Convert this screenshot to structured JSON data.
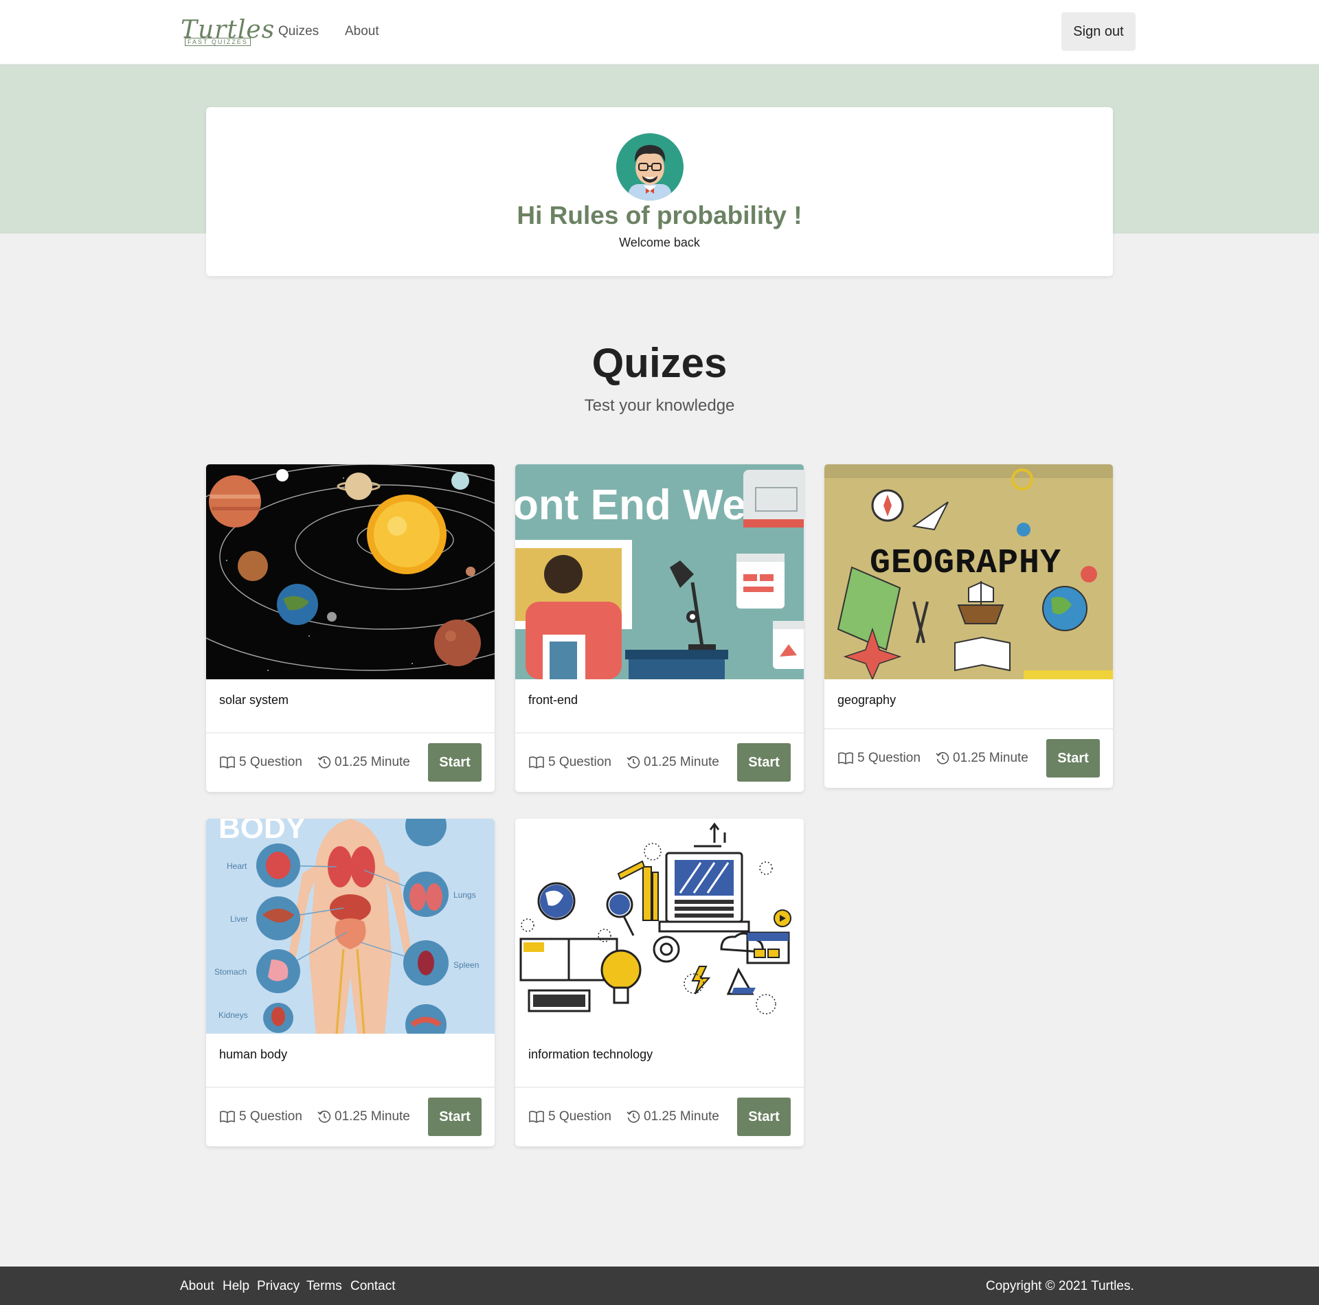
{
  "nav": {
    "logo_text": "Turtles",
    "logo_sub": "FAST QUIZZES",
    "links": [
      "Quizes",
      "About"
    ],
    "signout_label": "Sign out"
  },
  "profile": {
    "greeting": "Hi Rules of probability !",
    "welcome": "Welcome back"
  },
  "section": {
    "title": "Quizes",
    "subtitle": "Test your knowledge"
  },
  "cards": [
    {
      "title": "solar system",
      "questions": "5 Question",
      "duration": "01.25 Minute",
      "start_label": "Start",
      "image_text": ""
    },
    {
      "title": "front-end",
      "questions": "5 Question",
      "duration": "01.25 Minute",
      "start_label": "Start",
      "image_text": "ont End Web"
    },
    {
      "title": "geography",
      "questions": "5 Question",
      "duration": "01.25 Minute",
      "start_label": "Start",
      "image_text": "GEOGRAPHY"
    },
    {
      "title": "human body",
      "questions": "5 Question",
      "duration": "01.25 Minute",
      "start_label": "Start",
      "image_text": "BODY"
    },
    {
      "title": "information technology",
      "questions": "5 Question",
      "duration": "01.25 Minute",
      "start_label": "Start",
      "image_text": ""
    }
  ],
  "footer": {
    "links": [
      "About",
      "Help",
      "Privacy",
      "Terms",
      "Contact"
    ],
    "copyright": "Copyright © 2021 Turtles."
  },
  "colors": {
    "accent": "#6b8263",
    "hero_band": "#d3e0d4",
    "page_bg": "#f0f0f0",
    "footer_bg": "#3b3b3b"
  },
  "icons": {
    "question_icon": "book-icon",
    "duration_icon": "history-clock-icon"
  }
}
